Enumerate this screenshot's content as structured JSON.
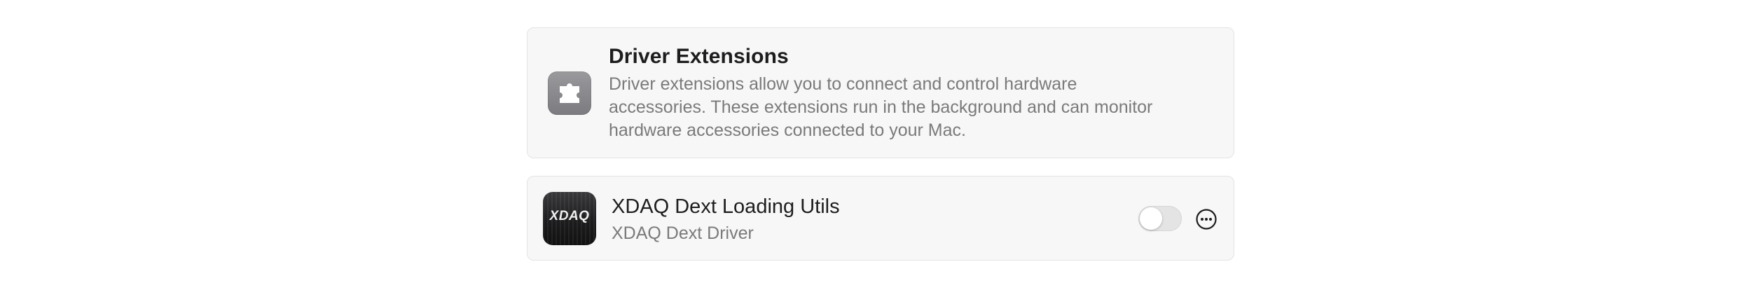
{
  "header": {
    "title": "Driver Extensions",
    "description": "Driver extensions allow you to connect and control hardware accessories. These extensions run in the background and can monitor hardware accessories connected to your Mac.",
    "icon": "puzzle-piece-icon"
  },
  "extensions": [
    {
      "name": "XDAQ Dext Loading Utils",
      "subtitle": "XDAQ Dext Driver",
      "logo_text": "XDAQ",
      "enabled": false,
      "more_icon": "ellipsis-circle-icon"
    }
  ],
  "colors": {
    "card_background": "#f7f7f7",
    "card_border": "#e3e3e3",
    "primary_text": "#1d1d1f",
    "secondary_text": "#7a7a7a",
    "toggle_off": "#e4e4e4"
  }
}
